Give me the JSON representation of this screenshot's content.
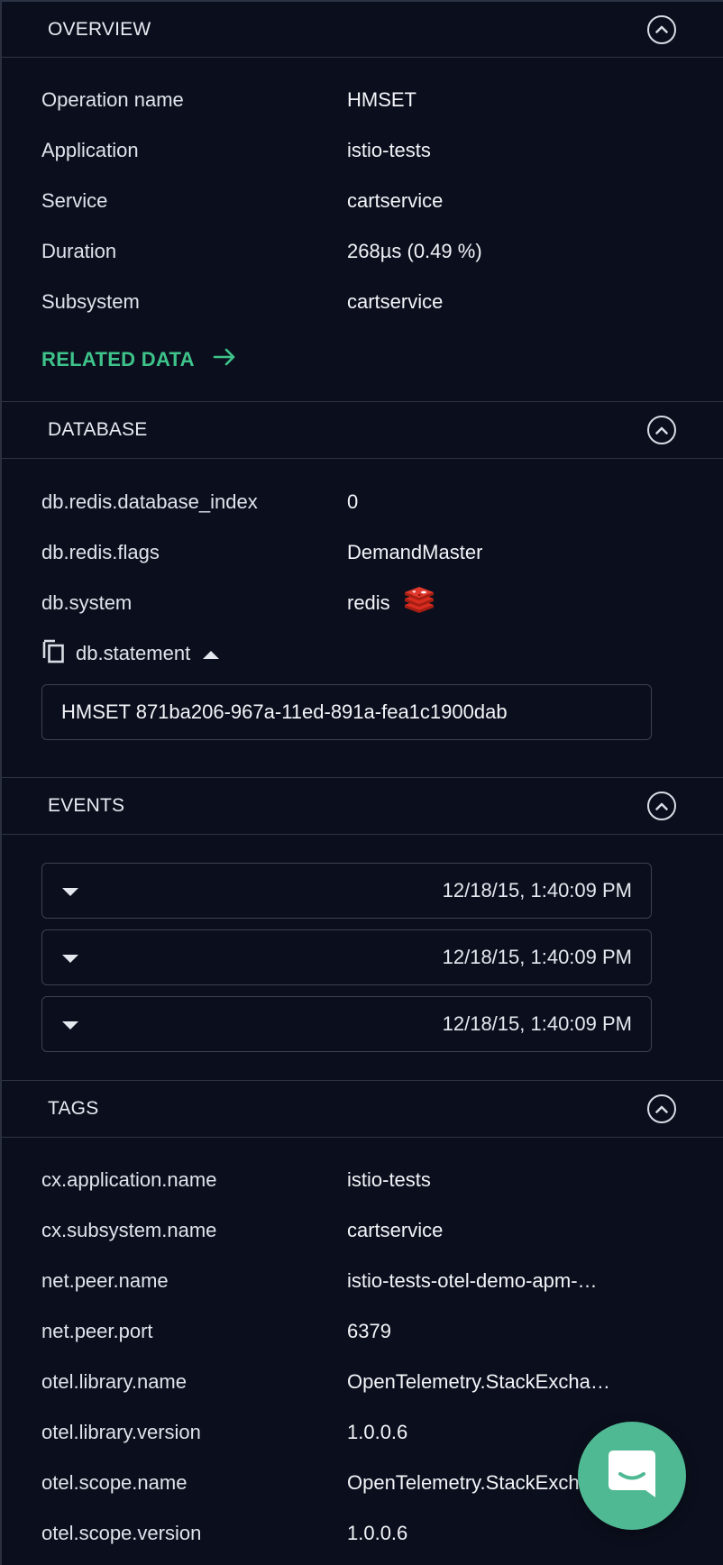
{
  "overview": {
    "title": "OVERVIEW",
    "rows": [
      {
        "key": "Operation name",
        "value": "HMSET"
      },
      {
        "key": "Application",
        "value": "istio-tests"
      },
      {
        "key": "Service",
        "value": "cartservice"
      },
      {
        "key": "Duration",
        "value": "268µs (0.49 %)"
      },
      {
        "key": "Subsystem",
        "value": "cartservice"
      }
    ],
    "related_label": "RELATED DATA"
  },
  "database": {
    "title": "DATABASE",
    "rows": [
      {
        "key": "db.redis.database_index",
        "value": "0"
      },
      {
        "key": "db.redis.flags",
        "value": "DemandMaster"
      },
      {
        "key": "db.system",
        "value": "redis"
      }
    ],
    "statement_label": "db.statement",
    "statement_value": "HMSET 871ba206-967a-11ed-891a-fea1c1900dab"
  },
  "events": {
    "title": "EVENTS",
    "items": [
      {
        "time": "12/18/15, 1:40:09 PM"
      },
      {
        "time": "12/18/15, 1:40:09 PM"
      },
      {
        "time": "12/18/15, 1:40:09 PM"
      }
    ]
  },
  "tags": {
    "title": "TAGS",
    "rows": [
      {
        "key": "cx.application.name",
        "value": "istio-tests"
      },
      {
        "key": "cx.subsystem.name",
        "value": "cartservice"
      },
      {
        "key": "net.peer.name",
        "value": "istio-tests-otel-demo-apm-…"
      },
      {
        "key": "net.peer.port",
        "value": "6379"
      },
      {
        "key": "otel.library.name",
        "value": "OpenTelemetry.StackExcha…"
      },
      {
        "key": "otel.library.version",
        "value": "1.0.0.6"
      },
      {
        "key": "otel.scope.name",
        "value": "OpenTelemetry.StackExch…"
      },
      {
        "key": "otel.scope.version",
        "value": "1.0.0.6"
      }
    ]
  },
  "colors": {
    "background": "#0b0f1d",
    "accent_green": "#3ec48b",
    "chat_button": "#4fb993",
    "redis_red": "#c6302b"
  },
  "icons": {
    "collapse": "chevron-up-circle-icon",
    "related": "arrow-right-icon",
    "db_system": "redis-logo-icon",
    "copy": "copy-icon",
    "statement_toggle": "caret-up-icon",
    "event_toggle": "caret-down-icon",
    "chat": "chat-bubble-icon"
  }
}
